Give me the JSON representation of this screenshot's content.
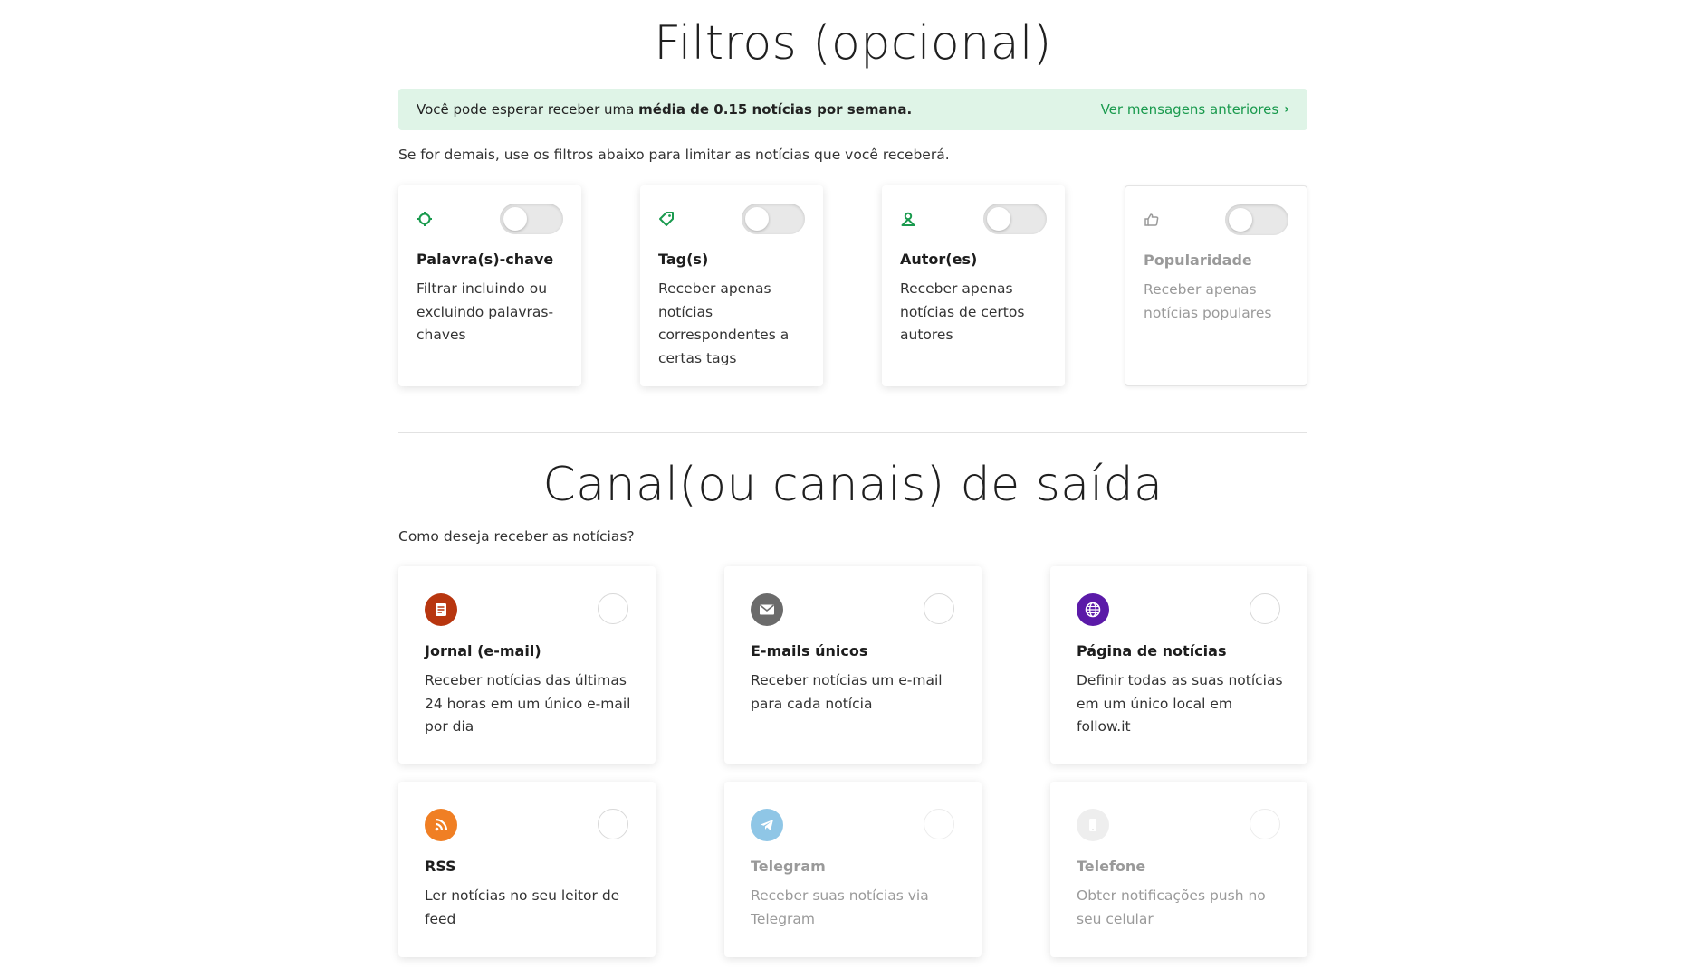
{
  "filters_section": {
    "title": "Filtros (opcional)",
    "info_prefix": "Você pode esperar receber uma ",
    "info_bold": "média de 0.15 notícias por semana.",
    "prev_messages_link": "Ver mensagens anteriores",
    "hint": "Se for demais, use os filtros abaixo para limitar as notícias que você receberá.",
    "cards": [
      {
        "icon": "target-icon",
        "title": "Palavra(s)-chave",
        "desc": "Filtrar incluindo ou excluindo palavras-chaves",
        "enabled": false
      },
      {
        "icon": "tag-icon",
        "title": "Tag(s)",
        "desc": "Receber apenas notícias correspondentes a certas tags",
        "enabled": false
      },
      {
        "icon": "user-icon",
        "title": "Autor(es)",
        "desc": "Receber apenas notícias de certos autores",
        "enabled": false
      },
      {
        "icon": "thumbs-up-icon",
        "title": "Popularidade",
        "desc": "Receber apenas notícias populares",
        "enabled": false
      }
    ]
  },
  "channels_section": {
    "title": "Canal(ou canais) de saída",
    "hint": "Como deseja receber as notícias?",
    "cards": [
      {
        "icon": "newspaper-icon",
        "title": "Jornal (e-mail)",
        "desc": "Receber notícias das últimas 24 horas em um único e-mail por dia",
        "color": "#b8360f"
      },
      {
        "icon": "envelope-icon",
        "title": "E-mails únicos",
        "desc": "Receber notícias um e-mail para cada notícia",
        "color": "#6b6b6b"
      },
      {
        "icon": "globe-icon",
        "title": "Página de notícias",
        "desc": "Definir todas as suas notícias em um único local em follow.it",
        "color": "#5b1aa8"
      },
      {
        "icon": "rss-icon",
        "title": "RSS",
        "desc": "Ler notícias no seu leitor de feed",
        "color": "#f07f24"
      },
      {
        "icon": "telegram-icon",
        "title": "Telegram",
        "desc": "Receber suas notícias via Telegram",
        "color": "#8fc6e6"
      },
      {
        "icon": "phone-icon",
        "title": "Telefone",
        "desc": "Obter notificações push no seu celular",
        "color": "#eeeeee"
      }
    ]
  },
  "colors": {
    "accent_green": "#1a9a4e",
    "info_bg": "#dff4e7"
  }
}
